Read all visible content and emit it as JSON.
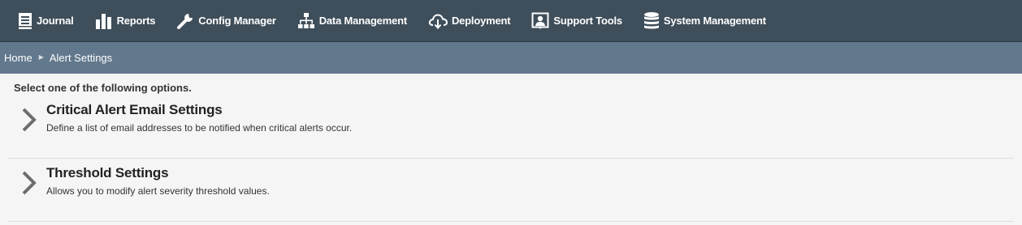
{
  "nav": {
    "items": [
      {
        "label": "Journal",
        "icon": "journal-icon"
      },
      {
        "label": "Reports",
        "icon": "bar-chart-icon"
      },
      {
        "label": "Config Manager",
        "icon": "wrench-icon"
      },
      {
        "label": "Data Management",
        "icon": "sitemap-icon"
      },
      {
        "label": "Deployment",
        "icon": "cloud-download-icon"
      },
      {
        "label": "Support Tools",
        "icon": "user-portrait-icon"
      },
      {
        "label": "System Management",
        "icon": "database-icon"
      }
    ]
  },
  "breadcrumb": {
    "home": "Home",
    "current": "Alert Settings"
  },
  "main": {
    "instruction": "Select one of the following options.",
    "options": [
      {
        "title": "Critical Alert Email Settings",
        "description": "Define a list of email addresses to be notified when critical alerts occur."
      },
      {
        "title": "Threshold Settings",
        "description": "Allows you to modify alert severity threshold values."
      }
    ]
  },
  "colors": {
    "topnav_bg": "#3e4e5a",
    "breadcrumb_bg": "#62788d",
    "content_bg": "#f5f5f5",
    "chevron": "#6d6d6d"
  }
}
